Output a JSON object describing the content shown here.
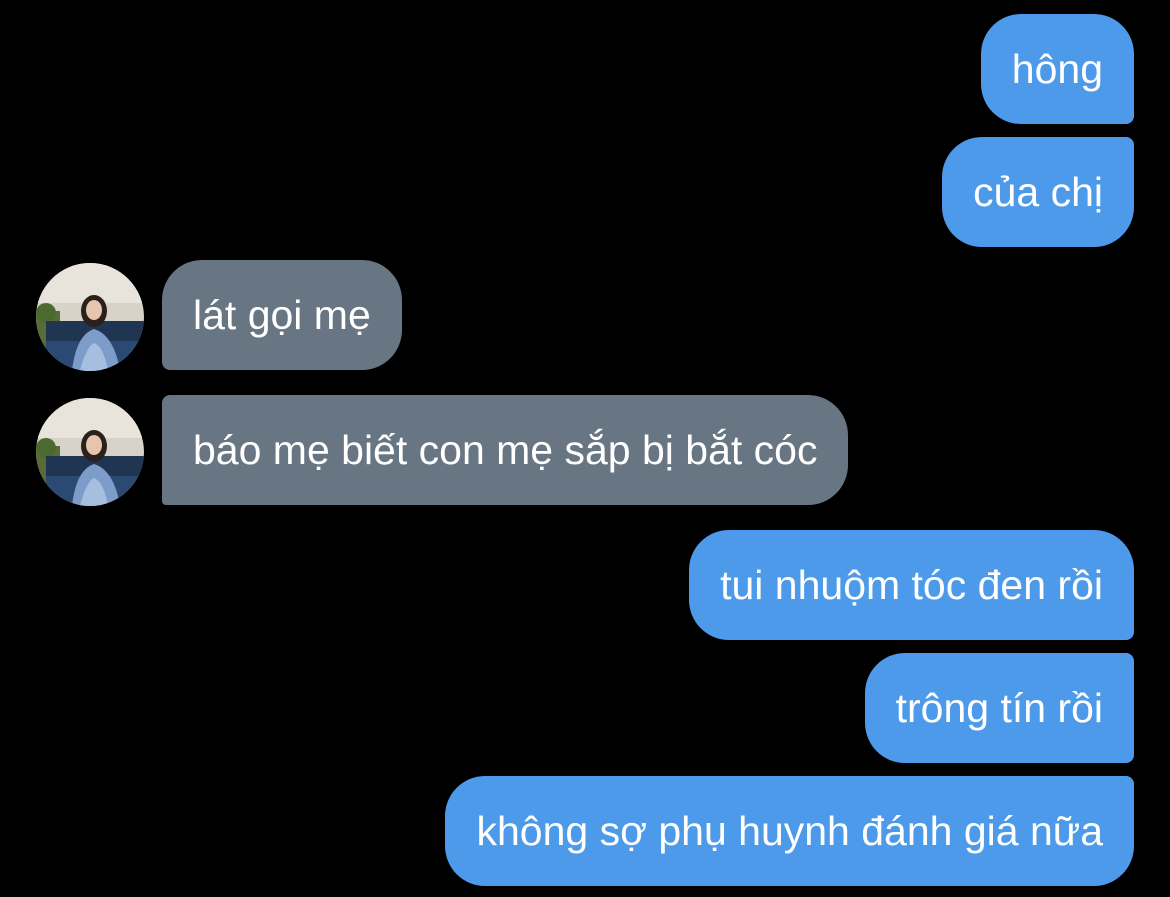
{
  "conversation": {
    "messages": [
      {
        "sender": "me",
        "text": "hông"
      },
      {
        "sender": "me",
        "text": "của chị"
      },
      {
        "sender": "them",
        "text": "lát gọi mẹ"
      },
      {
        "sender": "them",
        "text": "báo mẹ biết con mẹ sắp bị bắt cóc"
      },
      {
        "sender": "me",
        "text": "tui nhuộm tóc đen rồi"
      },
      {
        "sender": "me",
        "text": "trông tín rồi"
      },
      {
        "sender": "me",
        "text": "không sợ phụ huynh đánh giá nữa"
      }
    ]
  },
  "colors": {
    "background": "#000000",
    "sent_bubble": "#4d9aea",
    "received_bubble": "#687582",
    "text": "#ffffff"
  },
  "icons": {
    "contact_avatar": "contact-avatar-photo"
  }
}
